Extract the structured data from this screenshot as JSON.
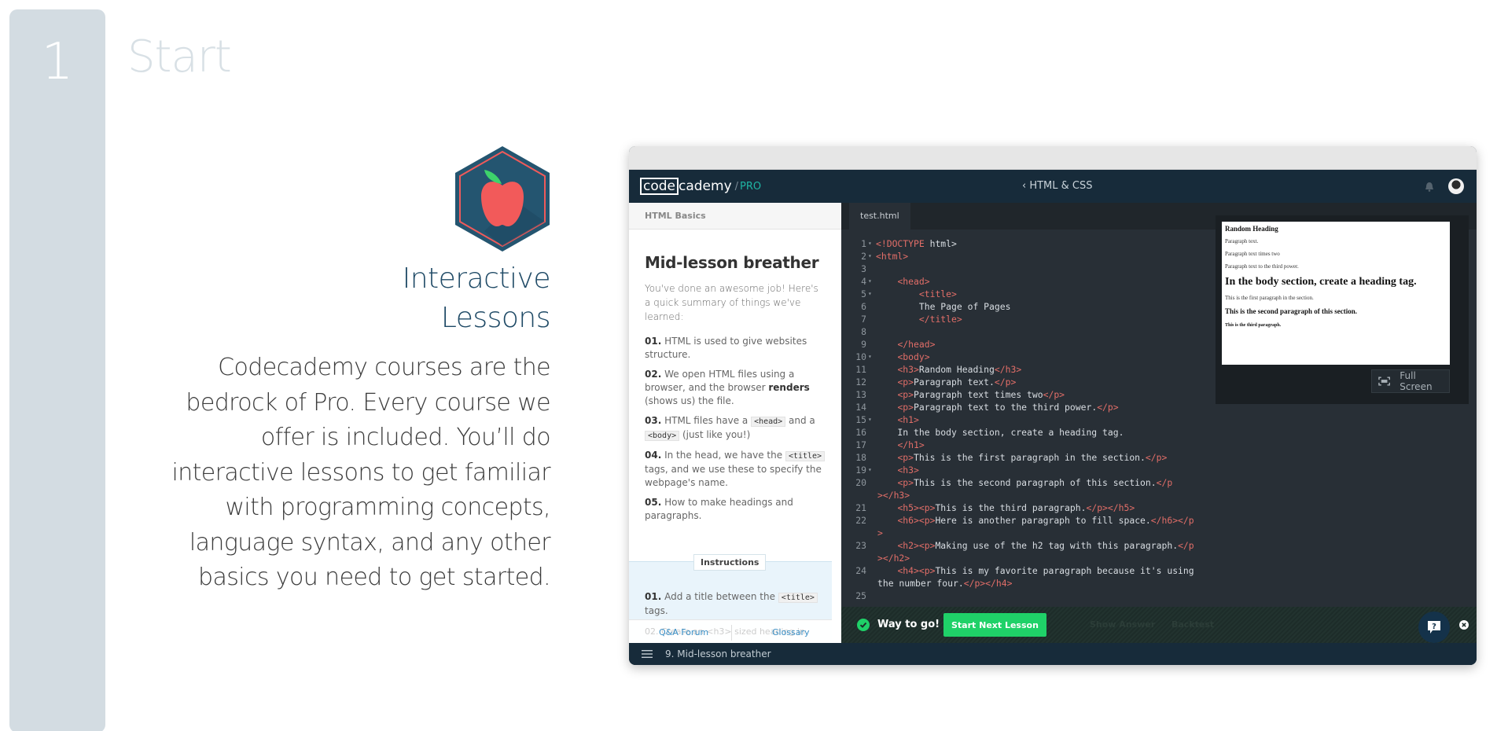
{
  "step": {
    "number": "1",
    "title": "Start"
  },
  "feature": {
    "icon": "apple-hexagon-icon",
    "title_line1": "Interactive",
    "title_line2": "Lessons",
    "description": "Codecademy courses are the bedrock of Pro. Every course we offer is included. You’ll do interactive lessons to get familiar with programming concepts, language syntax, and any other basics you need to get started."
  },
  "app": {
    "logo_box": "code",
    "logo_rest": "cademy",
    "logo_sep": "/",
    "logo_pro": "PRO",
    "course_link": "‹ HTML & CSS",
    "colors": {
      "header": "#172b3a",
      "accent_green": "#1fd168",
      "pro_teal": "#1fb5a4",
      "tag_red": "#e26e68"
    }
  },
  "lesson": {
    "breadcrumb": "HTML Basics",
    "title": "Mid-lesson breather",
    "intro": "You've done an awesome job! Here's a quick summary of things we've learned:",
    "items": [
      {
        "num": "01.",
        "text": "HTML is used to give websites structure."
      },
      {
        "num": "02.",
        "text_before": "We open HTML files using a browser, and the browser ",
        "bold": "renders",
        "text_after": " (shows us) the file."
      },
      {
        "num": "03.",
        "text_before": "HTML files have a ",
        "code1": "<head>",
        "text_mid": " and a ",
        "code2": "<body>",
        "text_after": " (just like you!)"
      },
      {
        "num": "04.",
        "text_before": "In the head, we have the ",
        "code1": "<title>",
        "text_after": " tags, and we use these to specify the webpage's name."
      },
      {
        "num": "05.",
        "text": "How to make headings and paragraphs."
      }
    ],
    "instructions_label": "Instructions",
    "instruction_1": {
      "num": "01.",
      "text_before": "Add a title between the ",
      "code": "<title>",
      "text_after": " tags."
    },
    "instruction_2_ghost": "02. Create an <h3> sized heading in",
    "footer": {
      "qa": "Q&A Forum",
      "glossary": "Glossary"
    }
  },
  "editor": {
    "file_tab": "test.html",
    "lines": [
      {
        "n": "1",
        "fold": true,
        "parts": [
          [
            "tag",
            "<!"
          ],
          [
            "tag",
            "DOCTYPE"
          ],
          [
            "txt",
            " html>"
          ]
        ]
      },
      {
        "n": "2",
        "fold": true,
        "parts": [
          [
            "tag",
            "<html>"
          ]
        ]
      },
      {
        "n": "3",
        "parts": []
      },
      {
        "n": "4",
        "fold": true,
        "parts": [
          [
            "txt",
            "    "
          ],
          [
            "tag",
            "<head>"
          ]
        ]
      },
      {
        "n": "5",
        "fold": true,
        "parts": [
          [
            "txt",
            "        "
          ],
          [
            "tag",
            "<title>"
          ]
        ]
      },
      {
        "n": "6",
        "parts": [
          [
            "txt",
            "        The Page of Pages"
          ]
        ]
      },
      {
        "n": "7",
        "parts": [
          [
            "txt",
            "        "
          ],
          [
            "tag",
            "</title>"
          ]
        ]
      },
      {
        "n": "8",
        "parts": []
      },
      {
        "n": "9",
        "parts": [
          [
            "txt",
            "    "
          ],
          [
            "tag",
            "</head>"
          ]
        ]
      },
      {
        "n": "10",
        "fold": true,
        "parts": [
          [
            "txt",
            "    "
          ],
          [
            "tag",
            "<body>"
          ]
        ]
      },
      {
        "n": "11",
        "parts": [
          [
            "txt",
            "    "
          ],
          [
            "tag",
            "<h3>"
          ],
          [
            "txt",
            "Random Heading"
          ],
          [
            "tag",
            "</h3>"
          ]
        ]
      },
      {
        "n": "12",
        "parts": [
          [
            "txt",
            "    "
          ],
          [
            "tag",
            "<p>"
          ],
          [
            "txt",
            "Paragraph text."
          ],
          [
            "tag",
            "</p>"
          ]
        ]
      },
      {
        "n": "13",
        "parts": [
          [
            "txt",
            "    "
          ],
          [
            "tag",
            "<p>"
          ],
          [
            "txt",
            "Paragraph text times two"
          ],
          [
            "tag",
            "</p>"
          ]
        ]
      },
      {
        "n": "14",
        "parts": [
          [
            "txt",
            "    "
          ],
          [
            "tag",
            "<p>"
          ],
          [
            "txt",
            "Paragraph text to the third power."
          ],
          [
            "tag",
            "</p>"
          ]
        ]
      },
      {
        "n": "15",
        "fold": true,
        "parts": [
          [
            "txt",
            "    "
          ],
          [
            "tag",
            "<h1>"
          ]
        ]
      },
      {
        "n": "16",
        "parts": [
          [
            "txt",
            "    In the body section, create a heading tag."
          ]
        ]
      },
      {
        "n": "17",
        "parts": [
          [
            "txt",
            "    "
          ],
          [
            "tag",
            "</h1>"
          ]
        ]
      },
      {
        "n": "18",
        "parts": [
          [
            "txt",
            "    "
          ],
          [
            "tag",
            "<p>"
          ],
          [
            "txt",
            "This is the first paragraph in the section."
          ],
          [
            "tag",
            "</p>"
          ]
        ]
      },
      {
        "n": "19",
        "fold": true,
        "parts": [
          [
            "txt",
            "    "
          ],
          [
            "tag",
            "<h3>"
          ]
        ]
      },
      {
        "n": "20",
        "parts": [
          [
            "txt",
            "    "
          ],
          [
            "tag",
            "<p>"
          ],
          [
            "txt",
            "This is the second paragraph of this section."
          ],
          [
            "tag",
            "</p"
          ]
        ],
        "wrap": [
          [
            "tag",
            "></h3>"
          ]
        ]
      },
      {
        "n": "21",
        "parts": [
          [
            "txt",
            "    "
          ],
          [
            "tag",
            "<h5><p>"
          ],
          [
            "txt",
            "This is the third paragraph."
          ],
          [
            "tag",
            "</p></h5>"
          ]
        ]
      },
      {
        "n": "22",
        "parts": [
          [
            "txt",
            "    "
          ],
          [
            "tag",
            "<h6><p>"
          ],
          [
            "txt",
            "Here is another paragraph to fill space."
          ],
          [
            "tag",
            "</h6></p"
          ]
        ],
        "wrap": [
          [
            "tag",
            ">"
          ]
        ]
      },
      {
        "n": "23",
        "parts": [
          [
            "txt",
            "    "
          ],
          [
            "tag",
            "<h2><p>"
          ],
          [
            "txt",
            "Making use of the h2 tag with this paragraph."
          ],
          [
            "tag",
            "</p"
          ]
        ],
        "wrap": [
          [
            "tag",
            "></h2>"
          ]
        ]
      },
      {
        "n": "24",
        "parts": [
          [
            "txt",
            "    "
          ],
          [
            "tag",
            "<h4><p>"
          ],
          [
            "txt",
            "This is my favorite paragraph because it's using"
          ]
        ],
        "wrap": [
          [
            "txt",
            "the number four."
          ],
          [
            "tag",
            "</p></h4>"
          ]
        ]
      },
      {
        "n": "25",
        "parts": []
      }
    ]
  },
  "preview": {
    "h3": "Random Heading",
    "p1": "Paragraph text.",
    "p2": "Paragraph text times two",
    "p3": "Paragraph text to the third power.",
    "h1": "In the body section, create a heading tag.",
    "p4": "This is the first paragraph in the section.",
    "h3b": "This is the second paragraph of this section.",
    "h5": "This is the third paragraph.",
    "fullscreen_label": "Full Screen"
  },
  "actions": {
    "success": "Way to go!",
    "next": "Start Next Lesson",
    "show_answer": "Show Answer",
    "backtest": "Backtest"
  },
  "bottom": {
    "lesson": "9. Mid-lesson breather"
  }
}
